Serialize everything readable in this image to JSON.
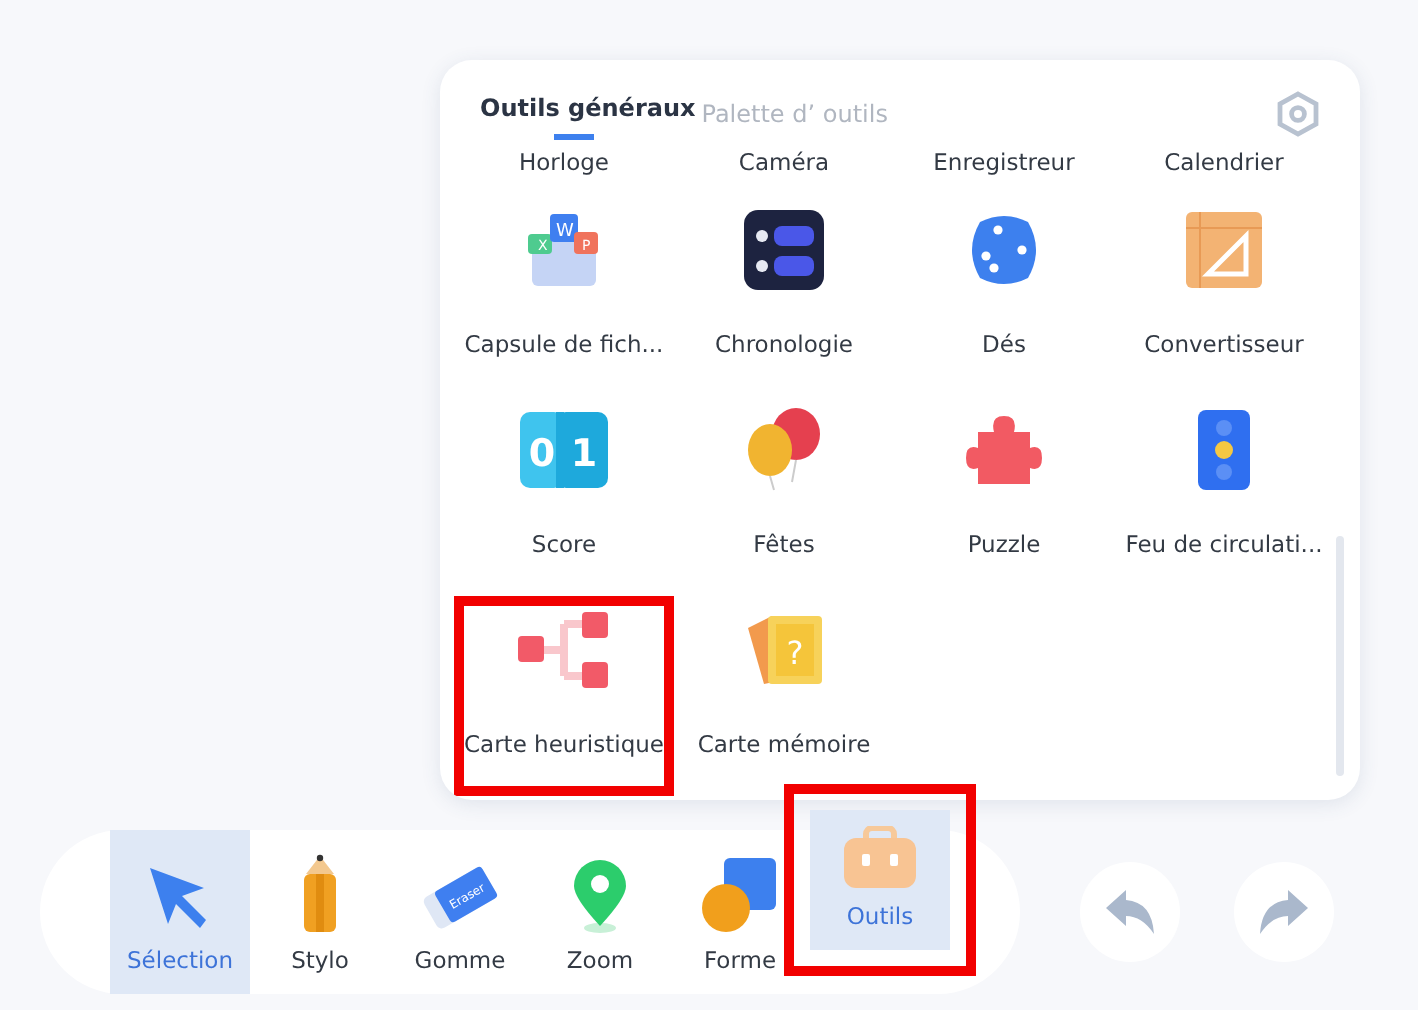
{
  "panel": {
    "tabs": [
      {
        "label": "Outils généraux",
        "selected": true
      },
      {
        "label": "Palette d’ outils",
        "selected": false
      }
    ],
    "tools": [
      {
        "label": "Horloge",
        "kind": "cut",
        "highlighted": false
      },
      {
        "label": "Caméra",
        "kind": "cut",
        "highlighted": false
      },
      {
        "label": "Enregistreur",
        "kind": "cut",
        "highlighted": false
      },
      {
        "label": "Calendrier",
        "kind": "cut",
        "highlighted": false
      },
      {
        "label": "Capsule de fich...",
        "kind": "files",
        "highlighted": false,
        "glyphs": [
          "W",
          "X",
          "P"
        ]
      },
      {
        "label": "Chronologie",
        "kind": "timeline",
        "highlighted": false
      },
      {
        "label": "Dés",
        "kind": "dice",
        "highlighted": false
      },
      {
        "label": "Convertisseur",
        "kind": "ruler",
        "highlighted": false
      },
      {
        "label": "Score",
        "kind": "score",
        "highlighted": false,
        "glyphs": [
          "0",
          "1"
        ]
      },
      {
        "label": "Fêtes",
        "kind": "balloons",
        "highlighted": false
      },
      {
        "label": "Puzzle",
        "kind": "puzzle",
        "highlighted": false
      },
      {
        "label": "Feu de circulati...",
        "kind": "traffic",
        "highlighted": false
      },
      {
        "label": "Carte heuristique",
        "kind": "mindmap",
        "highlighted": true
      },
      {
        "label": "Carte mémoire",
        "kind": "card",
        "highlighted": false,
        "glyphs": [
          "?"
        ]
      }
    ]
  },
  "toolbar": [
    {
      "label": "Sélection",
      "kind": "cursor",
      "selected": true,
      "highlighted": false
    },
    {
      "label": "Stylo",
      "kind": "pencil",
      "selected": false,
      "highlighted": false
    },
    {
      "label": "Gomme",
      "kind": "eraser",
      "selected": false,
      "highlighted": false,
      "glyphs": [
        "Eraser"
      ]
    },
    {
      "label": "Zoom",
      "kind": "pin",
      "selected": false,
      "highlighted": false
    },
    {
      "label": "Forme",
      "kind": "shapes",
      "selected": false,
      "highlighted": false
    },
    {
      "label": "Outils",
      "kind": "toolbox",
      "selected": true,
      "highlighted": true
    }
  ]
}
